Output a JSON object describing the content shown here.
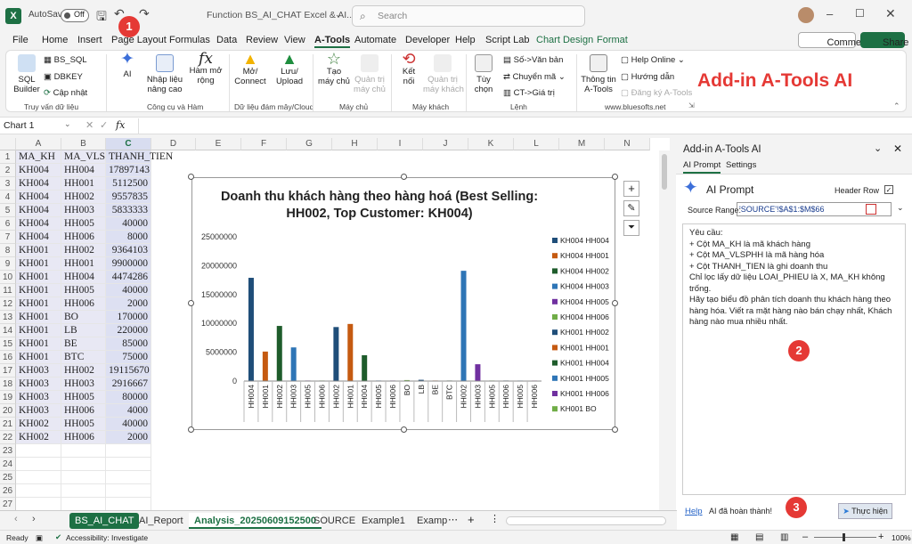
{
  "titlebar": {
    "autosave": "AutoSave",
    "toggle": "Off",
    "file_title": "Function BS_AI_CHAT Excel & AI...",
    "search_placeholder": "Search"
  },
  "menu": [
    "File",
    "Home",
    "Insert",
    "Page Layout",
    "Formulas",
    "Data",
    "Review",
    "View",
    "A-Tools",
    "Automate",
    "Developer",
    "Help",
    "Script Lab",
    "Chart Design",
    "Format"
  ],
  "menu_right": {
    "comments": "Comments",
    "share": "Share"
  },
  "ribbon": {
    "sql_builder": "SQL\nBuilder",
    "bs_sql": "BS_SQL",
    "dbkey": "DBKEY",
    "cap_nhat": "Cập nhật",
    "g1": "Truy vấn dữ liệu",
    "ai": "AI",
    "nhap_lieu": "Nhập liệu\nnâng cao",
    "ham_mo_rong": "Hàm mở\nrộng",
    "g2": "Công cụ và Hàm",
    "mo_connect": "Mở/\nConnect",
    "luu_upload": "Lưu/\nUpload",
    "g3": "Dữ liệu đám mây/Cloud",
    "tao_may_chu": "Tạo\nmáy chủ",
    "quan_tri_may_chu": "Quản trị\nmáy chủ",
    "g4": "Máy chủ",
    "ket_noi": "Kết\nnối",
    "quan_tri_may_khach": "Quản trị\nmáy khách",
    "g5": "Máy khách",
    "tuy_chon": "Tùy\nchọn",
    "so_van_ban": "Số->Văn bản",
    "chuyen_ma": "Chuyển mã",
    "ct_gia_tri": "CT->Giá trị",
    "g6": "Lệnh",
    "thong_tin": "Thông tin\nA-Tools",
    "help_online": "Help Online",
    "huong_dan": "Hướng dẫn",
    "dang_ky": "Đăng ký A-Tools",
    "g7": "www.bluesofts.net",
    "banner": "Add-in A-Tools AI"
  },
  "formula_bar": {
    "name_box": "Chart 1",
    "fx": "fx"
  },
  "columns": [
    "A",
    "B",
    "C",
    "D",
    "E",
    "F",
    "G",
    "H",
    "I",
    "J",
    "K",
    "L",
    "M",
    "N"
  ],
  "rows": [
    [
      "MA_KH",
      "MA_VLSPH",
      "THANH_TIEN"
    ],
    [
      "KH004",
      "HH004",
      "17897143"
    ],
    [
      "KH004",
      "HH001",
      "5112500"
    ],
    [
      "KH004",
      "HH002",
      "9557835"
    ],
    [
      "KH004",
      "HH003",
      "5833333"
    ],
    [
      "KH004",
      "HH005",
      "40000"
    ],
    [
      "KH004",
      "HH006",
      "8000"
    ],
    [
      "KH001",
      "HH002",
      "9364103"
    ],
    [
      "KH001",
      "HH001",
      "9900000"
    ],
    [
      "KH001",
      "HH004",
      "4474286"
    ],
    [
      "KH001",
      "HH005",
      "40000"
    ],
    [
      "KH001",
      "HH006",
      "2000"
    ],
    [
      "KH001",
      "BO",
      "170000"
    ],
    [
      "KH001",
      "LB",
      "220000"
    ],
    [
      "KH001",
      "BE",
      "85000"
    ],
    [
      "KH001",
      "BTC",
      "75000"
    ],
    [
      "KH003",
      "HH002",
      "19115670"
    ],
    [
      "KH003",
      "HH003",
      "2916667"
    ],
    [
      "KH003",
      "HH005",
      "80000"
    ],
    [
      "KH003",
      "HH006",
      "4000"
    ],
    [
      "KH002",
      "HH005",
      "40000"
    ],
    [
      "KH002",
      "HH006",
      "2000"
    ]
  ],
  "chart_data": {
    "type": "bar",
    "title": "Doanh thu khách hàng theo hàng hoá (Best Selling: HH002, Top Customer: KH004)",
    "ylim": [
      0,
      25000000
    ],
    "yticks": [
      "25000000",
      "20000000",
      "15000000",
      "10000000",
      "5000000",
      "0"
    ],
    "categories": [
      "HH004",
      "HH001",
      "HH002",
      "HH003",
      "HH005",
      "HH006",
      "HH002",
      "HH001",
      "HH004",
      "HH005",
      "HH006",
      "BO",
      "LB",
      "BE",
      "BTC",
      "HH002",
      "HH003",
      "HH005",
      "HH006",
      "HH005",
      "HH006"
    ],
    "groups": [
      "KH004",
      "KH004",
      "KH004",
      "KH004",
      "KH004",
      "KH004",
      "KH001",
      "KH001",
      "KH001",
      "KH001",
      "KH001",
      "KH001",
      "KH001",
      "KH001",
      "KH001",
      "KH003",
      "KH003",
      "KH003",
      "KH003",
      "KH002",
      "KH002"
    ],
    "values": [
      17897143,
      5112500,
      9557835,
      5833333,
      40000,
      8000,
      9364103,
      9900000,
      4474286,
      40000,
      2000,
      170000,
      220000,
      85000,
      75000,
      19115670,
      2916667,
      80000,
      4000,
      40000,
      2000
    ],
    "colors": [
      "#1f4e79",
      "#c55a11",
      "#1e5c2b",
      "#2e75b6",
      "#7030a0",
      "#70ad47",
      "#1f4e79",
      "#c55a11",
      "#1e5c2b",
      "#2e75b6",
      "#7030a0",
      "#70ad47",
      "#1f4e79",
      "#c55a11",
      "#1e5c2b",
      "#2e75b6",
      "#7030a0",
      "#70ad47",
      "#1f4e79",
      "#6fa8dc",
      "#c479c4"
    ],
    "legend": [
      "KH004 HH004",
      "KH004 HH001",
      "KH004 HH002",
      "KH004 HH003",
      "KH004 HH005",
      "KH004 HH006",
      "KH001 HH002",
      "KH001 HH001",
      "KH001 HH004",
      "KH001 HH005",
      "KH001 HH006",
      "KH001 BO"
    ]
  },
  "panel": {
    "title": "Add-in A-Tools AI",
    "tab_prompt": "AI Prompt",
    "tab_settings": "Settings",
    "header": "AI Prompt",
    "header_row": "Header Row",
    "source_label": "Source Range:",
    "source_value": "'SOURCE'!$A$1:$M$66",
    "prompt": "Yêu cầu:\n+ Cột MA_KH là mã khách hàng\n+ Cột MA_VLSPHH là mã hàng hóa\n+ Cột THANH_TIEN là ghi doanh thu\nChỉ lọc lấy dữ liệu LOAI_PHIEU là X, MA_KH không trống.\nHãy tạo biểu đồ phân tích doanh thu khách hàng theo hàng hóa. Viết ra mặt hàng nào bán chạy nhất, Khách hàng nào mua nhiều nhất.",
    "help": "Help",
    "status": "AI đã hoàn thành!",
    "run": "Thực hiện"
  },
  "sheets": [
    "BS_AI_CHAT",
    "AI_Report",
    "Analysis_20250609152500",
    "SOURCE",
    "Example1",
    "Examp"
  ],
  "statusbar": {
    "ready": "Ready",
    "accessibility": "Accessibility: Investigate",
    "zoom": "100%"
  },
  "badges": [
    "1",
    "2",
    "3"
  ]
}
